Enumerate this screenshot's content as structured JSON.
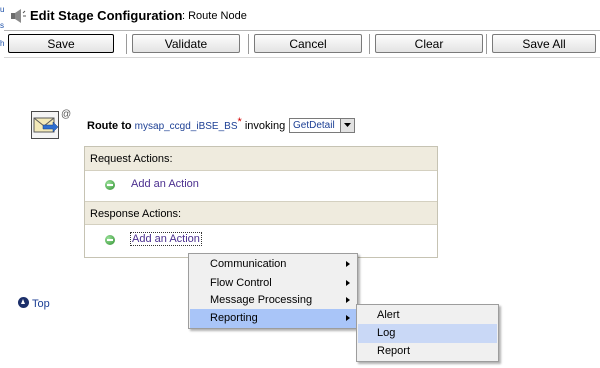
{
  "header": {
    "title": "Edit Stage Configuration",
    "subtitle": ": Route Node"
  },
  "left_edge": [
    "u",
    "s",
    "h"
  ],
  "toolbar": {
    "save_label": "Save",
    "validate_label": "Validate",
    "cancel_label": "Cancel",
    "clear_label": "Clear",
    "save_all_label": "Save All"
  },
  "route": {
    "at_symbol": "@",
    "prefix": "Route to",
    "service": "mysap_ccgd_iBSE_BS",
    "required_mark": "*",
    "invoking": "invoking",
    "operation": "GetDetail"
  },
  "panel": {
    "request_header": "Request Actions:",
    "request_add": "Add an Action",
    "response_header": "Response Actions:",
    "response_add": "Add an Action"
  },
  "top_link": "Top",
  "context_menu": {
    "items": [
      "Communication",
      "Flow Control",
      "Message Processing",
      "Reporting"
    ],
    "active": "Reporting"
  },
  "submenu": {
    "items": [
      "Alert",
      "Log",
      "Report"
    ],
    "hover": "Log"
  },
  "colors": {
    "link": "#1c3f94",
    "action_link": "#4b2f8f",
    "section_bg": "#efebde",
    "menu_highlight": "#a9c5f8"
  }
}
